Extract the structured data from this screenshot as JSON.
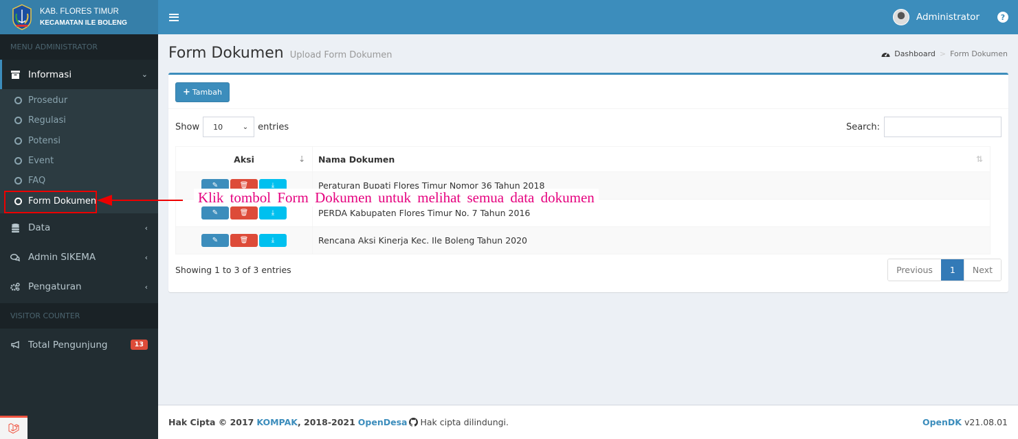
{
  "brand": {
    "line1": "KAB. FLORES TIMUR",
    "line2": "KECAMATAN ILE BOLENG"
  },
  "topbar": {
    "user_name": "Administrator",
    "help_icon": "?"
  },
  "sidebar": {
    "header": "MENU ADMINISTRATOR",
    "informasi": {
      "label": "Informasi",
      "icon": "archive-icon",
      "sub_items": [
        {
          "label": "Prosedur"
        },
        {
          "label": "Regulasi"
        },
        {
          "label": "Potensi"
        },
        {
          "label": "Event"
        },
        {
          "label": "FAQ"
        },
        {
          "label": "Form Dokumen",
          "active": true
        }
      ]
    },
    "items": [
      {
        "label": "Data",
        "icon": "database-icon"
      },
      {
        "label": "Admin SIKEMA",
        "icon": "comments-icon"
      },
      {
        "label": "Pengaturan",
        "icon": "cogs-icon"
      }
    ],
    "visitor_header": "VISITOR COUNTER",
    "visitor": {
      "label": "Total Pengunjung",
      "count": "13",
      "icon": "bullhorn-icon"
    }
  },
  "page": {
    "title": "Form Dokumen",
    "subtitle": "Upload Form Dokumen",
    "breadcrumb": {
      "home": "Dashboard",
      "separator": ">",
      "current": "Form Dokumen"
    }
  },
  "box": {
    "add_button": "Tambah",
    "length": {
      "show": "Show",
      "value": "10",
      "entries": "entries"
    },
    "search": {
      "label": "Search:",
      "value": ""
    },
    "columns": [
      "Aksi",
      "Nama Dokumen"
    ],
    "rows": [
      {
        "name": "Peraturan Bupati Flores Timur Nomor 36 Tahun 2018"
      },
      {
        "name": "PERDA Kabupaten Flores Timur No. 7 Tahun 2016"
      },
      {
        "name": "Rencana Aksi Kinerja Kec. Ile Boleng Tahun 2020"
      }
    ],
    "info": "Showing 1 to 3 of 3 entries",
    "pagination": {
      "previous": "Previous",
      "current": "1",
      "next": "Next"
    }
  },
  "footer": {
    "prefix": "Hak Cipta © 2017",
    "kompak": "KOMPAK",
    "years": ", 2018-2021",
    "opendesa": "OpenDesa",
    "rights": "Hak cipta dilindungi.",
    "product": "OpenDK",
    "version": "v21.08.01"
  },
  "annotation": {
    "text": "Klik tombol Form Dokumen untuk melihat semua data dokumen",
    "color": "#e5007e"
  },
  "colors": {
    "primary": "#3c8dbc",
    "danger": "#dd4b39",
    "info": "#00c0ef",
    "sidebar_bg": "#222d32"
  }
}
